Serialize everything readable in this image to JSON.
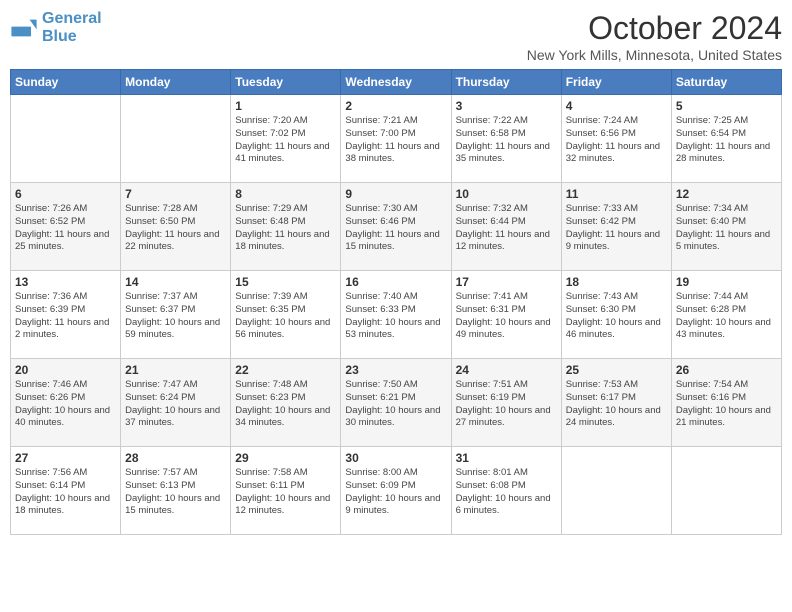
{
  "header": {
    "logo_line1": "General",
    "logo_line2": "Blue",
    "month": "October 2024",
    "location": "New York Mills, Minnesota, United States"
  },
  "days_of_week": [
    "Sunday",
    "Monday",
    "Tuesday",
    "Wednesday",
    "Thursday",
    "Friday",
    "Saturday"
  ],
  "weeks": [
    [
      {
        "day": "",
        "info": ""
      },
      {
        "day": "",
        "info": ""
      },
      {
        "day": "1",
        "info": "Sunrise: 7:20 AM\nSunset: 7:02 PM\nDaylight: 11 hours and 41 minutes."
      },
      {
        "day": "2",
        "info": "Sunrise: 7:21 AM\nSunset: 7:00 PM\nDaylight: 11 hours and 38 minutes."
      },
      {
        "day": "3",
        "info": "Sunrise: 7:22 AM\nSunset: 6:58 PM\nDaylight: 11 hours and 35 minutes."
      },
      {
        "day": "4",
        "info": "Sunrise: 7:24 AM\nSunset: 6:56 PM\nDaylight: 11 hours and 32 minutes."
      },
      {
        "day": "5",
        "info": "Sunrise: 7:25 AM\nSunset: 6:54 PM\nDaylight: 11 hours and 28 minutes."
      }
    ],
    [
      {
        "day": "6",
        "info": "Sunrise: 7:26 AM\nSunset: 6:52 PM\nDaylight: 11 hours and 25 minutes."
      },
      {
        "day": "7",
        "info": "Sunrise: 7:28 AM\nSunset: 6:50 PM\nDaylight: 11 hours and 22 minutes."
      },
      {
        "day": "8",
        "info": "Sunrise: 7:29 AM\nSunset: 6:48 PM\nDaylight: 11 hours and 18 minutes."
      },
      {
        "day": "9",
        "info": "Sunrise: 7:30 AM\nSunset: 6:46 PM\nDaylight: 11 hours and 15 minutes."
      },
      {
        "day": "10",
        "info": "Sunrise: 7:32 AM\nSunset: 6:44 PM\nDaylight: 11 hours and 12 minutes."
      },
      {
        "day": "11",
        "info": "Sunrise: 7:33 AM\nSunset: 6:42 PM\nDaylight: 11 hours and 9 minutes."
      },
      {
        "day": "12",
        "info": "Sunrise: 7:34 AM\nSunset: 6:40 PM\nDaylight: 11 hours and 5 minutes."
      }
    ],
    [
      {
        "day": "13",
        "info": "Sunrise: 7:36 AM\nSunset: 6:39 PM\nDaylight: 11 hours and 2 minutes."
      },
      {
        "day": "14",
        "info": "Sunrise: 7:37 AM\nSunset: 6:37 PM\nDaylight: 10 hours and 59 minutes."
      },
      {
        "day": "15",
        "info": "Sunrise: 7:39 AM\nSunset: 6:35 PM\nDaylight: 10 hours and 56 minutes."
      },
      {
        "day": "16",
        "info": "Sunrise: 7:40 AM\nSunset: 6:33 PM\nDaylight: 10 hours and 53 minutes."
      },
      {
        "day": "17",
        "info": "Sunrise: 7:41 AM\nSunset: 6:31 PM\nDaylight: 10 hours and 49 minutes."
      },
      {
        "day": "18",
        "info": "Sunrise: 7:43 AM\nSunset: 6:30 PM\nDaylight: 10 hours and 46 minutes."
      },
      {
        "day": "19",
        "info": "Sunrise: 7:44 AM\nSunset: 6:28 PM\nDaylight: 10 hours and 43 minutes."
      }
    ],
    [
      {
        "day": "20",
        "info": "Sunrise: 7:46 AM\nSunset: 6:26 PM\nDaylight: 10 hours and 40 minutes."
      },
      {
        "day": "21",
        "info": "Sunrise: 7:47 AM\nSunset: 6:24 PM\nDaylight: 10 hours and 37 minutes."
      },
      {
        "day": "22",
        "info": "Sunrise: 7:48 AM\nSunset: 6:23 PM\nDaylight: 10 hours and 34 minutes."
      },
      {
        "day": "23",
        "info": "Sunrise: 7:50 AM\nSunset: 6:21 PM\nDaylight: 10 hours and 30 minutes."
      },
      {
        "day": "24",
        "info": "Sunrise: 7:51 AM\nSunset: 6:19 PM\nDaylight: 10 hours and 27 minutes."
      },
      {
        "day": "25",
        "info": "Sunrise: 7:53 AM\nSunset: 6:17 PM\nDaylight: 10 hours and 24 minutes."
      },
      {
        "day": "26",
        "info": "Sunrise: 7:54 AM\nSunset: 6:16 PM\nDaylight: 10 hours and 21 minutes."
      }
    ],
    [
      {
        "day": "27",
        "info": "Sunrise: 7:56 AM\nSunset: 6:14 PM\nDaylight: 10 hours and 18 minutes."
      },
      {
        "day": "28",
        "info": "Sunrise: 7:57 AM\nSunset: 6:13 PM\nDaylight: 10 hours and 15 minutes."
      },
      {
        "day": "29",
        "info": "Sunrise: 7:58 AM\nSunset: 6:11 PM\nDaylight: 10 hours and 12 minutes."
      },
      {
        "day": "30",
        "info": "Sunrise: 8:00 AM\nSunset: 6:09 PM\nDaylight: 10 hours and 9 minutes."
      },
      {
        "day": "31",
        "info": "Sunrise: 8:01 AM\nSunset: 6:08 PM\nDaylight: 10 hours and 6 minutes."
      },
      {
        "day": "",
        "info": ""
      },
      {
        "day": "",
        "info": ""
      }
    ]
  ]
}
